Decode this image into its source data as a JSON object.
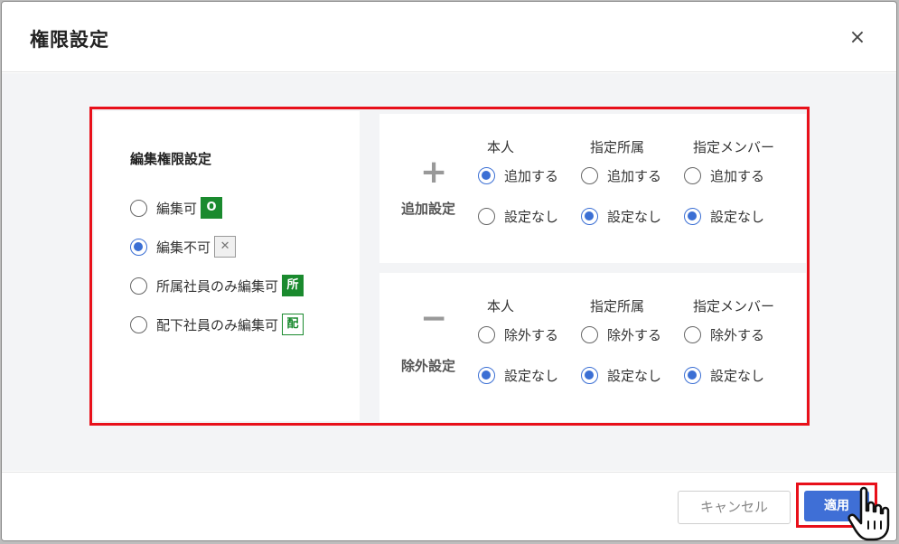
{
  "dialog": {
    "title": "権限設定",
    "close_glyph": "×"
  },
  "left": {
    "title": "編集権限設定",
    "options": [
      {
        "label": "編集可",
        "badge": "O",
        "selected": false
      },
      {
        "label": "編集不可",
        "badge": "✕",
        "selected": true
      },
      {
        "label": "所属社員のみ編集可",
        "badge": "所",
        "selected": false
      },
      {
        "label": "配下社員のみ編集可",
        "badge": "配",
        "selected": false
      }
    ]
  },
  "add": {
    "symbol": "+",
    "label": "追加設定",
    "columns": [
      "本人",
      "指定所属",
      "指定メンバー"
    ],
    "option_yes": "追加する",
    "option_no": "設定なし",
    "selected": [
      "yes",
      "no",
      "no"
    ]
  },
  "remove": {
    "symbol": "−",
    "label": "除外設定",
    "columns": [
      "本人",
      "指定所属",
      "指定メンバー"
    ],
    "option_yes": "除外する",
    "option_no": "設定なし",
    "selected": [
      "no",
      "no",
      "no"
    ]
  },
  "footer": {
    "cancel_label": "キャンセル",
    "apply_label": "適用"
  },
  "colors": {
    "accent": "#3f6fd6",
    "highlight": "#e8101a",
    "badge_green": "#1a8a2e"
  },
  "icons": {
    "close": "close-icon",
    "cursor": "hand-pointer-icon"
  }
}
